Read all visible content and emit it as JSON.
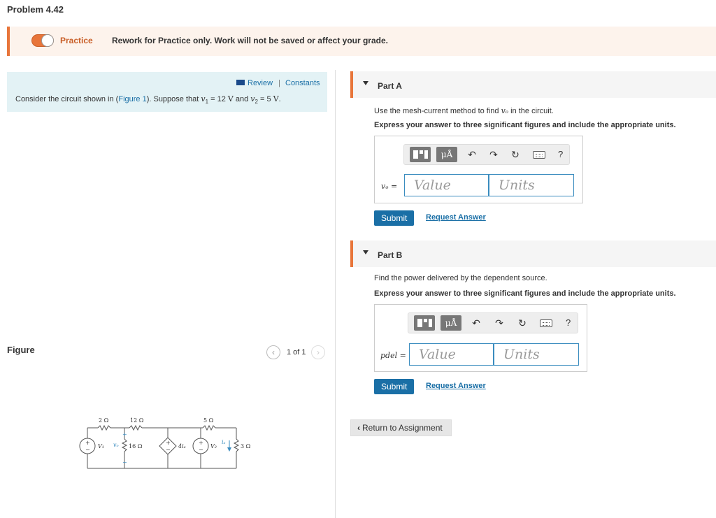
{
  "problem": {
    "title": "Problem 4.42"
  },
  "practice": {
    "label": "Practice",
    "message": "Rework for Practice only. Work will not be saved or affect your grade."
  },
  "info": {
    "review": "Review",
    "separator": "|",
    "constants": "Constants",
    "text_before": "Consider the circuit shown in (",
    "figure_link": "Figure 1",
    "text_mid": "). Suppose that ",
    "v1_sym": "v",
    "v1_sub": "1",
    "v1_eq": " = 12 ",
    "v1_unit": "V",
    "and": " and ",
    "v2_sym": "v",
    "v2_sub": "2",
    "v2_eq": " = 5 ",
    "v2_unit": "V",
    "end": "."
  },
  "figure": {
    "label": "Figure",
    "pager_text": "1 of 1",
    "prev_icon": "chevron-left-icon",
    "next_icon": "chevron-right-icon",
    "circuit": {
      "r1": "2 Ω",
      "r2": "12 Ω",
      "r3": "5 Ω",
      "r4": "16 Ω",
      "r5": "3 Ω",
      "src1": "V₁",
      "src2": "V₂",
      "vo": "vₒ",
      "dep": "4iₐ",
      "ia": "iₐ",
      "plus": "+",
      "minus": "−"
    }
  },
  "part_a": {
    "title": "Part A",
    "instr_pre": "Use the mesh-current method to find ",
    "instr_var": "vₒ",
    "instr_post": " in the circuit.",
    "express": "Express your answer to three significant figures and include the appropriate units.",
    "var_label": "vₒ =",
    "value_placeholder": "Value",
    "units_placeholder": "Units",
    "submit": "Submit",
    "request": "Request Answer"
  },
  "part_b": {
    "title": "Part B",
    "instr": "Find the power delivered by the dependent source.",
    "express": "Express your answer to three significant figures and include the appropriate units.",
    "var_label": "pdel =",
    "value_placeholder": "Value",
    "units_placeholder": "Units",
    "submit": "Submit",
    "request": "Request Answer"
  },
  "toolbar": {
    "units_btn": "μÅ",
    "undo": "↶",
    "redo": "↷",
    "reset": "↻",
    "help": "?"
  },
  "return": {
    "label": "Return to Assignment"
  },
  "colors": {
    "accent": "#e8753a",
    "link": "#1a6fa6",
    "info_bg": "#e3f2f5"
  }
}
